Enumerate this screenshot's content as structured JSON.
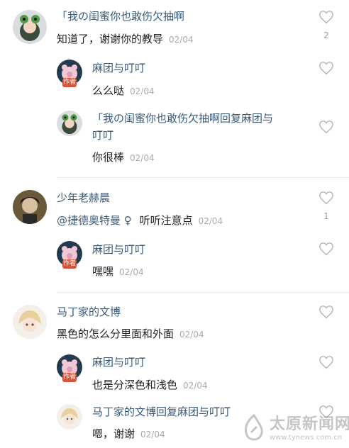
{
  "colors": {
    "accent_name": "#3a5a7a",
    "author_badge": "#d9533a"
  },
  "threads": [
    {
      "user": "「我の闺蜜你也敢伤欠抽啊",
      "text": "知道了，谢谢你的教导",
      "date": "02/04",
      "likes": "2",
      "replies": [
        {
          "user": "麻团与叮叮",
          "badge": "作者",
          "text": "么么哒",
          "date": "02/04"
        },
        {
          "user_line1": "「我の闺蜜你也敢伤欠抽啊回复麻团与",
          "user_line2": "叮叮",
          "text": "你很棒",
          "date": "02/04"
        }
      ]
    },
    {
      "user": "少年老赫晨",
      "mention": "@捷德奥特曼",
      "gender_icon": "♀",
      "text": "听听注意点",
      "date": "02/04",
      "likes": "1",
      "replies": [
        {
          "user": "麻团与叮叮",
          "badge": "作者",
          "text": "嘿嘿",
          "date": "02/04"
        }
      ]
    },
    {
      "user": "马丁家的文博",
      "text": "黑色的怎么分里面和外面",
      "date": "02/04",
      "replies": [
        {
          "user": "麻团与叮叮",
          "badge": "作者",
          "text": "也是分深色和浅色",
          "date": "02/04"
        },
        {
          "user": "马丁家的文博回复麻团与叮叮",
          "text": "嗯，谢谢",
          "date": "02/04"
        }
      ]
    }
  ],
  "watermark": {
    "title": "太原新闻网",
    "url": "www.tynews.com.cn"
  }
}
